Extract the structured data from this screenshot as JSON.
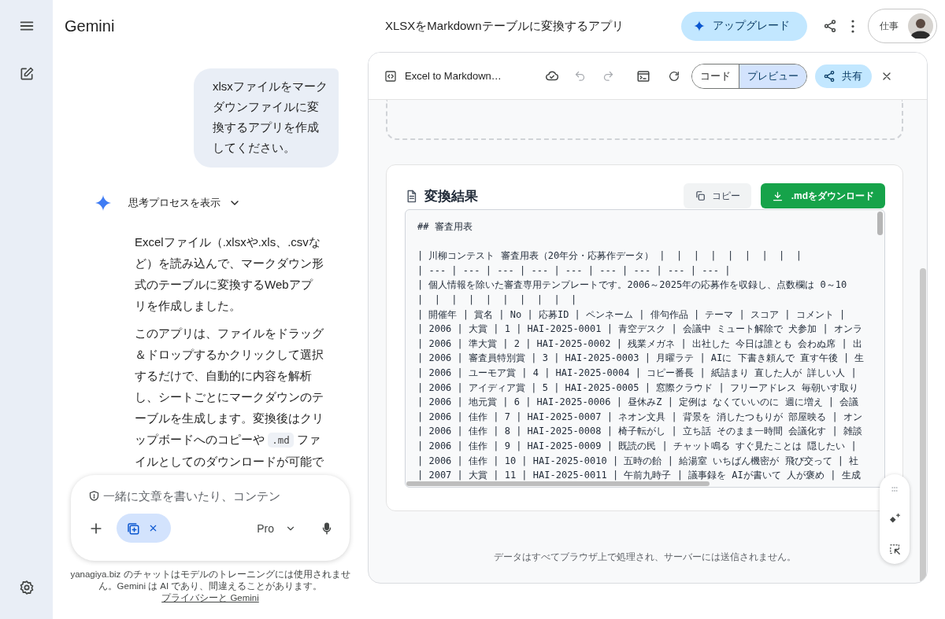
{
  "header": {
    "app_name": "Gemini",
    "title": "XLSXをMarkdownテーブルに変換するアプリ",
    "upgrade_button": "アップグレード",
    "account_label": "仕事"
  },
  "chat": {
    "user_message": "xlsxファイルをマークダウンファイルに変換するアプリを作成してください。",
    "thinking_toggle": {
      "label": "思考プロセスを表示",
      "expanded": false
    },
    "response": [
      [
        {
          "kind": "text",
          "text": "Excelファイル（.xlsxや.xls、.csvなど）を読み込んで、マークダウン形式のテーブルに変換するWebアプリを作成しました。"
        }
      ],
      [
        {
          "kind": "text",
          "text": "このアプリは、ファイルをドラッグ＆ドロップするかクリックして選択するだけで、自動的に内容を解析し、シートごとにマークダウンのテーブルを生成します。変換後はクリップボードへのコピーや "
        },
        {
          "kind": "code",
          "text": ".md"
        },
        {
          "kind": "text",
          "text": " ファイルとしてのダウンロードが可能で"
        }
      ]
    ]
  },
  "composer": {
    "placeholder": "一緒に文章を書いたり、コンテン",
    "model": "Pro"
  },
  "disclaimer": {
    "text": "yanagiya.biz のチャットはモデルのトレーニングには使用されません。Gemini は AI であり、間違えることがあります。",
    "link": "プライバシーと Gemini"
  },
  "canvas": {
    "title": "Excel to Markdown…",
    "view_tabs": [
      {
        "label": "コード",
        "selected": false
      },
      {
        "label": "プレビュー",
        "selected": true
      }
    ],
    "share_button": "共有",
    "result": {
      "heading": "変換結果",
      "copy_button": "コピー",
      "download_button": ".mdをダウンロード",
      "lines": [
        {
          "kind": "heading",
          "text": "## 審査用表"
        },
        "| 川柳コンテスト 審査用表（20年分・応募作データ） |  |  |  |  |  |  |  |  |",
        "| --- | --- | --- | --- | --- | --- | --- | --- | --- |",
        "| 個人情報を除いた審査専用テンプレートです。2006～2025年の応募作を収録し、点数欄は 0～10",
        "|  |  |  |  |  |  |  |  |  |",
        "| 開催年 | 賞名 | No | 応募ID | ペンネーム | 俳句作品 | テーマ | スコア | コメント |",
        "| 2006 | 大賞 | 1 | HAI-2025-0001 | 青空デスク | 会議中 ミュート解除で 犬参加 | オンラ",
        "| 2006 | 準大賞 | 2 | HAI-2025-0002 | 残業メガネ | 出社した 今日は誰とも 会わぬ席 | 出",
        "| 2006 | 審査員特別賞 | 3 | HAI-2025-0003 | 月曜ラテ | AIに 下書き頼んで 直す午後 | 生",
        "| 2006 | ユーモア賞 | 4 | HAI-2025-0004 | コピー番長 | 紙詰まり 直した人が 詳しい人 |",
        "| 2006 | アイディア賞 | 5 | HAI-2025-0005 | 窓際クラウド | フリーアドレス 毎朝いす取り",
        "| 2006 | 地元賞 | 6 | HAI-2025-0006 | 昼休みZ | 定例は なくていいのに 週に増え | 会議",
        "| 2006 | 佳作 | 7 | HAI-2025-0007 | ネオン文具 | 背景を 消したつもりが 部屋映る | オン",
        "| 2006 | 佳作 | 8 | HAI-2025-0008 | 椅子転がし | 立ち話 そのまま一時間 会議化す | 雑談",
        "| 2006 | 佳作 | 9 | HAI-2025-0009 | 既読の民 | チャット鳴る すぐ見たことは 隠したい |",
        "| 2006 | 佳作 | 10 | HAI-2025-0010 | 五時の飴 | 給湯室 いちばん機密が 飛び交って | 社",
        "| 2007 | 大賞 | 11 | HAI-2025-0011 | 午前九時子 | 議事録を AIが書いて 人が褒め | 生成"
      ]
    },
    "notice": "データはすべてブラウザ上で処理され、サーバーには送信されません。"
  }
}
